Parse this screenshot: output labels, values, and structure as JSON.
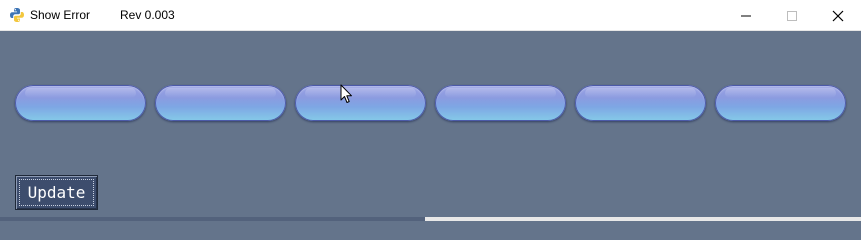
{
  "window": {
    "title": "Show Error",
    "revision": "Rev 0.003",
    "icon": "python-icon",
    "controls": [
      "minimize-icon",
      "maximize-icon",
      "close-icon"
    ]
  },
  "buttons": [
    {
      "label": ""
    },
    {
      "label": ""
    },
    {
      "label": ""
    },
    {
      "label": ""
    },
    {
      "label": ""
    },
    {
      "label": ""
    }
  ],
  "update_button": {
    "label": "Update"
  },
  "colors": {
    "background": "#64748b",
    "pill_top": "#9aa2e4",
    "pill_bottom": "#85cbe8",
    "update_bg": "#3d4d6d"
  }
}
